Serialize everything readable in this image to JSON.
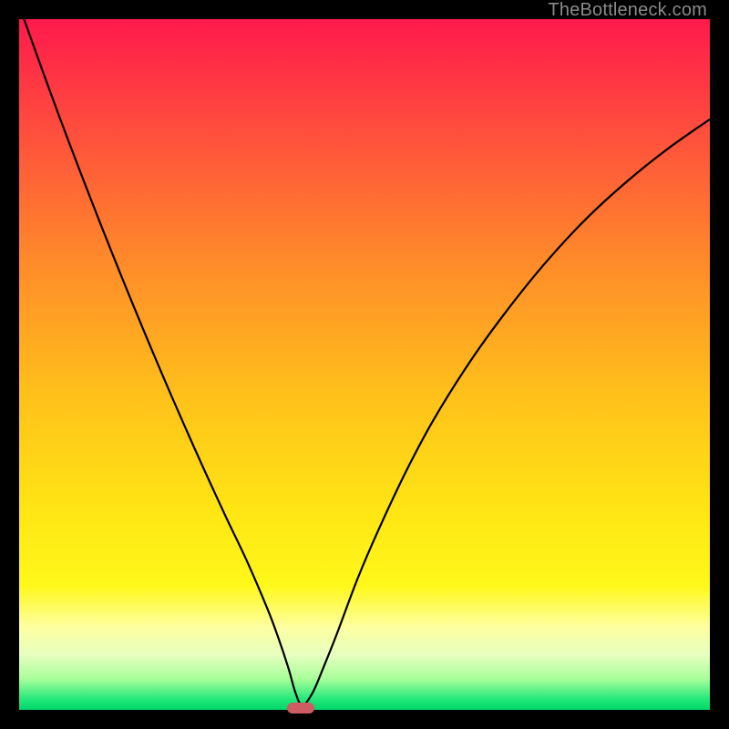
{
  "watermark": "TheBottleneck.com",
  "chart_data": {
    "type": "line",
    "title": "",
    "xlabel": "",
    "ylabel": "",
    "xlim": [
      0,
      100
    ],
    "ylim": [
      0,
      100
    ],
    "grid": false,
    "legend": false,
    "gradient_stops": [
      {
        "offset": 0.0,
        "color": "#ff1a4c"
      },
      {
        "offset": 0.15,
        "color": "#ff4a3e"
      },
      {
        "offset": 0.35,
        "color": "#ff8a2a"
      },
      {
        "offset": 0.55,
        "color": "#ffc21a"
      },
      {
        "offset": 0.72,
        "color": "#ffe714"
      },
      {
        "offset": 0.82,
        "color": "#fff81a"
      },
      {
        "offset": 0.88,
        "color": "#fdffa0"
      },
      {
        "offset": 0.92,
        "color": "#e8ffc0"
      },
      {
        "offset": 0.955,
        "color": "#a8ff9a"
      },
      {
        "offset": 0.985,
        "color": "#22e87a"
      },
      {
        "offset": 1.0,
        "color": "#00d66a"
      }
    ],
    "series": [
      {
        "name": "curve",
        "stroke": "#000000",
        "stroke_width": 2.2,
        "x": [
          0.0,
          3.0,
          6.0,
          9.0,
          12.0,
          15.0,
          18.0,
          21.0,
          24.0,
          27.0,
          30.0,
          33.0,
          36.0,
          37.5,
          39.0,
          40.0,
          41.0,
          42.5,
          44.0,
          46.0,
          49.0,
          52.0,
          56.0,
          60.0,
          65.0,
          70.0,
          76.0,
          82.0,
          88.0,
          94.0,
          100.0
        ],
        "y": [
          102.0,
          93.6,
          85.4,
          77.5,
          69.8,
          62.3,
          55.0,
          47.9,
          41.0,
          34.3,
          27.8,
          21.5,
          14.5,
          10.5,
          6.0,
          2.5,
          0.6,
          2.5,
          6.0,
          11.0,
          19.0,
          26.0,
          34.5,
          42.0,
          50.0,
          57.0,
          64.5,
          71.0,
          76.5,
          81.3,
          85.5
        ]
      }
    ],
    "marker": {
      "x": 40.7,
      "y": 0.0,
      "color": "#cd5d63"
    }
  }
}
